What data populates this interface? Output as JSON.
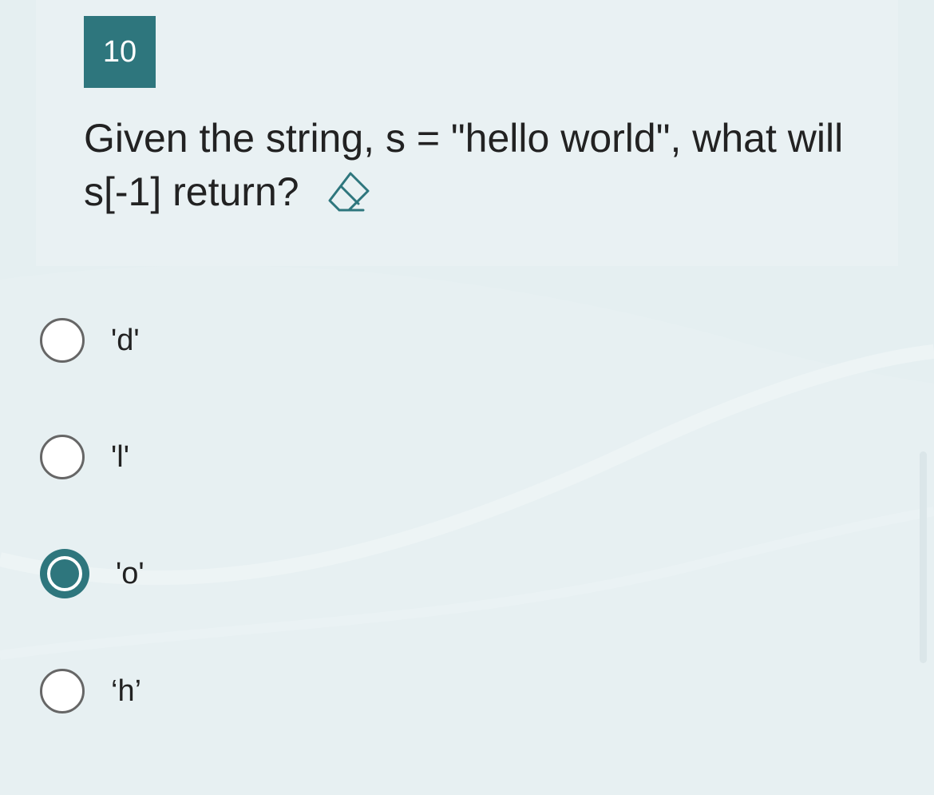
{
  "question": {
    "number": "10",
    "text": "Given the string, s = \"hello world\", what will s[-1] return?",
    "eraser_icon": "eraser-icon"
  },
  "options": [
    {
      "label": "'d'",
      "selected": false
    },
    {
      "label": "'l'",
      "selected": false
    },
    {
      "label": "'o'",
      "selected": true
    },
    {
      "label": "‘h’",
      "selected": false
    }
  ],
  "colors": {
    "accent": "#2e767d",
    "background": "#e5eff1",
    "text": "#222222"
  }
}
